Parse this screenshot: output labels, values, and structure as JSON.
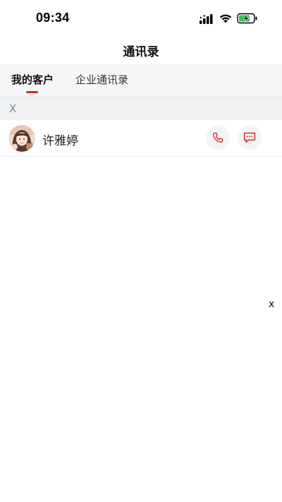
{
  "status_bar": {
    "time": "09:34",
    "icons": [
      "signal-icon",
      "wifi-icon",
      "battery-charging-icon"
    ]
  },
  "nav": {
    "title": "通讯录"
  },
  "tabs": [
    {
      "label": "我的客户",
      "active": true
    },
    {
      "label": "企业通讯录",
      "active": false
    }
  ],
  "contacts": {
    "index_letter": "X",
    "items": [
      {
        "name": "许雅婷",
        "avatar": "avatar-image",
        "actions": [
          "phone-icon",
          "message-icon"
        ]
      }
    ]
  },
  "side_index": {
    "letter": "x"
  },
  "colors": {
    "accent": "#d9262c",
    "tab_bar_bg": "#f5f6f8",
    "index_bg": "#f1f2f4",
    "battery_green": "#34c759"
  }
}
